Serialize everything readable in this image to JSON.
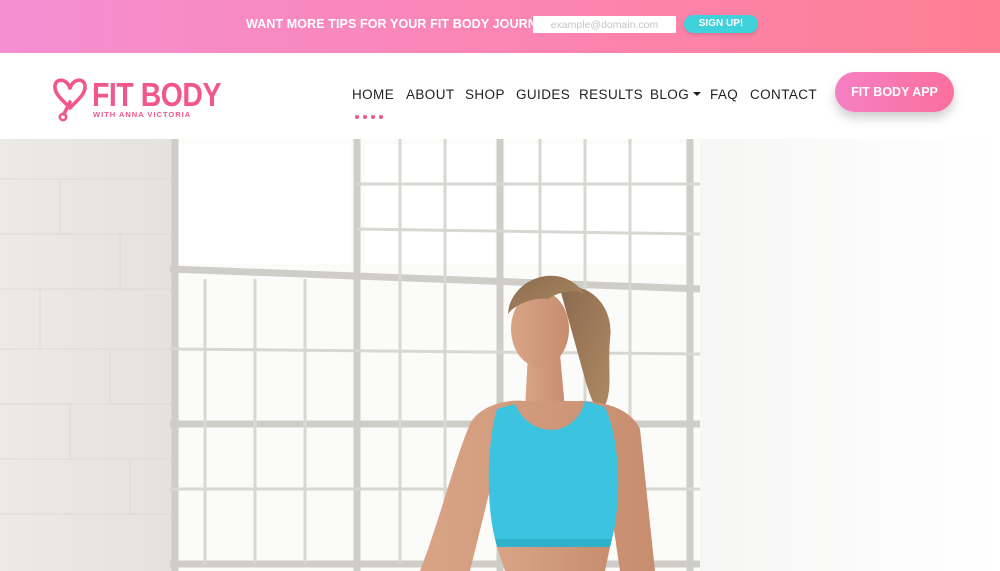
{
  "promo": {
    "text": "WANT MORE TIPS FOR YOUR FIT BODY JOURNEY?",
    "email_placeholder": "example@domain.com",
    "button_label": "SIGN UP!"
  },
  "brand": {
    "title": "FIT BODY",
    "subtitle": "WITH ANNA VICTORIA",
    "logo_icon": "heart-dumbbell-icon",
    "accent_color": "#f2568a"
  },
  "nav": {
    "items": [
      {
        "label": "HOME",
        "active": true
      },
      {
        "label": "ABOUT"
      },
      {
        "label": "SHOP"
      },
      {
        "label": "GUIDES"
      },
      {
        "label": "RESULTS"
      },
      {
        "label": "BLOG",
        "has_dropdown": true,
        "icon": "caret-down-icon"
      },
      {
        "label": "FAQ"
      },
      {
        "label": "CONTACT"
      }
    ]
  },
  "cta": {
    "app_button_label": "FIT BODY APP"
  },
  "colors": {
    "promo_gradient_start": "#f48fd2",
    "promo_gradient_end": "#fd7f93",
    "signup_button": "#3fd2db",
    "sports_bra": "#3cc3df"
  }
}
